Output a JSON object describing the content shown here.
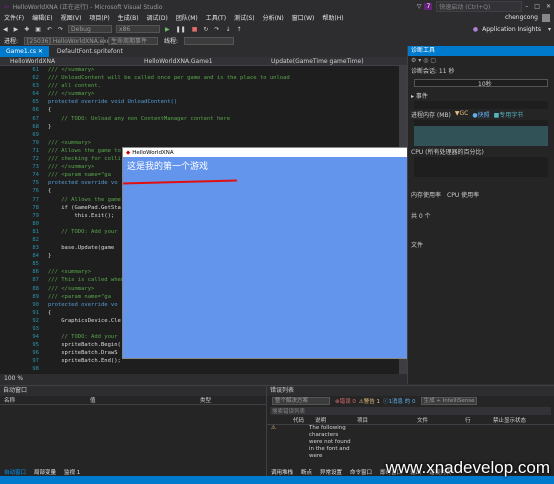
{
  "titlebar": {
    "title": "HelloWorldXNA (正在运行) - Microsoft Visual Studio",
    "badge": "7",
    "quick_launch": "快速启动 (Ctrl+Q)"
  },
  "menu": [
    "文件(F)",
    "编辑(E)",
    "视图(V)",
    "项目(P)",
    "生成(B)",
    "调试(D)",
    "团队(M)",
    "工具(T)",
    "测试(S)",
    "分析(N)",
    "窗口(W)",
    "帮助(H)"
  ],
  "user": "chengcong",
  "toolbar": {
    "config": "Debug",
    "platform": "x86",
    "insights": "Application Insights"
  },
  "procbar": {
    "process_label": "进程:",
    "process": "[25036] HelloWorldXNA.exe",
    "lifecycle": "生命周期事件",
    "thread": "线程:"
  },
  "tabs": [
    {
      "label": "Game1.cs",
      "active": true
    },
    {
      "label": "DefaultFont.spritefont",
      "active": false
    }
  ],
  "navbar": {
    "project": "HelloWorldXNA",
    "class": "HelloWorldXNA.Game1",
    "member": "Update(GameTime gameTime)"
  },
  "editor": {
    "lines": [
      {
        "n": "61",
        "t": "/// </summary>",
        "c": "cm"
      },
      {
        "n": "62",
        "t": "/// UnloadContent will be called once per game and is the place to unload",
        "c": "cm"
      },
      {
        "n": "63",
        "t": "/// all content.",
        "c": "cm"
      },
      {
        "n": "64",
        "t": "/// </summary>",
        "c": "cm"
      },
      {
        "n": "65",
        "t": "protected override void UnloadContent()",
        "c": "kw"
      },
      {
        "n": "66",
        "t": "{",
        "c": "tx"
      },
      {
        "n": "67",
        "t": "    // TODO: Unload any non ContentManager content here",
        "c": "cm"
      },
      {
        "n": "68",
        "t": "}",
        "c": "tx"
      },
      {
        "n": "69",
        "t": "",
        "c": "tx"
      },
      {
        "n": "70",
        "t": "/// <summary>",
        "c": "cm"
      },
      {
        "n": "71",
        "t": "/// Allows the game to run logic such as updating the world,",
        "c": "cm"
      },
      {
        "n": "72",
        "t": "/// checking for colli",
        "c": "cm"
      },
      {
        "n": "73",
        "t": "/// </summary>",
        "c": "cm"
      },
      {
        "n": "74",
        "t": "/// <param name=\"ga",
        "c": "cm"
      },
      {
        "n": "75",
        "t": "protected override vo",
        "c": "kw"
      },
      {
        "n": "76",
        "t": "{",
        "c": "tx"
      },
      {
        "n": "77",
        "t": "    // Allows the game",
        "c": "cm"
      },
      {
        "n": "78",
        "t": "    if (GamePad.GetSta",
        "c": "tx"
      },
      {
        "n": "79",
        "t": "        this.Exit();",
        "c": "tx"
      },
      {
        "n": "80",
        "t": "",
        "c": "tx"
      },
      {
        "n": "81",
        "t": "    // TODO: Add your",
        "c": "cm"
      },
      {
        "n": "82",
        "t": "",
        "c": "tx"
      },
      {
        "n": "83",
        "t": "    base.Update(game",
        "c": "tx"
      },
      {
        "n": "84",
        "t": "}",
        "c": "tx"
      },
      {
        "n": "85",
        "t": "",
        "c": "tx"
      },
      {
        "n": "86",
        "t": "/// <summary>",
        "c": "cm"
      },
      {
        "n": "87",
        "t": "/// This is called when",
        "c": "cm"
      },
      {
        "n": "88",
        "t": "/// </summary>",
        "c": "cm"
      },
      {
        "n": "89",
        "t": "/// <param name=\"ga",
        "c": "cm"
      },
      {
        "n": "90",
        "t": "protected override vo",
        "c": "kw"
      },
      {
        "n": "91",
        "t": "{",
        "c": "tx"
      },
      {
        "n": "92",
        "t": "    GraphicsDevice.Cle",
        "c": "tx"
      },
      {
        "n": "93",
        "t": "",
        "c": "tx"
      },
      {
        "n": "94",
        "t": "    // TODO: Add your",
        "c": "cm"
      },
      {
        "n": "95",
        "t": "    spriteBatch.Begin(",
        "c": "tx"
      },
      {
        "n": "96",
        "t": "    spriteBatch.DrawS",
        "c": "tx"
      },
      {
        "n": "97",
        "t": "    spriteBatch.End();",
        "c": "tx"
      },
      {
        "n": "98",
        "t": "",
        "c": "tx"
      },
      {
        "n": "99",
        "t": "    base.Draw(gameTi",
        "c": "tx"
      },
      {
        "n": "100",
        "t": "}",
        "c": "tx"
      },
      {
        "n": "101",
        "t": "}",
        "c": "tx"
      }
    ]
  },
  "zoom": "100 %",
  "xna": {
    "title": "HelloWorldXNA",
    "text": "这是我的第一个游戏"
  },
  "diagnostics": {
    "title": "诊断工具",
    "session": "诊断会话: 11 秒",
    "time_mark": "10秒",
    "events": "事件",
    "memory": "进程内存 (MB)",
    "legend": [
      "GC",
      "快照",
      "专用字节"
    ],
    "cpu": "CPU (所有处理器的百分比)",
    "cpu_tab1": "内存使用率",
    "cpu_tab2": "CPU 使用率",
    "count": "共 0 个",
    "file": "文件"
  },
  "autos": {
    "title": "自动窗口",
    "headers": [
      "名称",
      "值",
      "类型"
    ],
    "tabs": [
      "自动窗口",
      "局部变量",
      "监视 1"
    ]
  },
  "errors": {
    "title": "错误列表",
    "scope": "整个解决方案",
    "errors": "错误 0",
    "warnings": "警告 1",
    "messages": "1消息 的 0",
    "build": "生成 + IntelliSense",
    "search": "搜索错误列表",
    "headers": [
      "代码",
      "说明",
      "项目",
      "文件",
      "行",
      "禁止显示状态"
    ],
    "row": "The following characters were not found in the font and were",
    "tabs": [
      "调用堆栈",
      "断点",
      "异常设置",
      "命令窗口",
      "即时窗口",
      "输出",
      "错误列表"
    ]
  },
  "watermark": "www.xnadevelop.com"
}
